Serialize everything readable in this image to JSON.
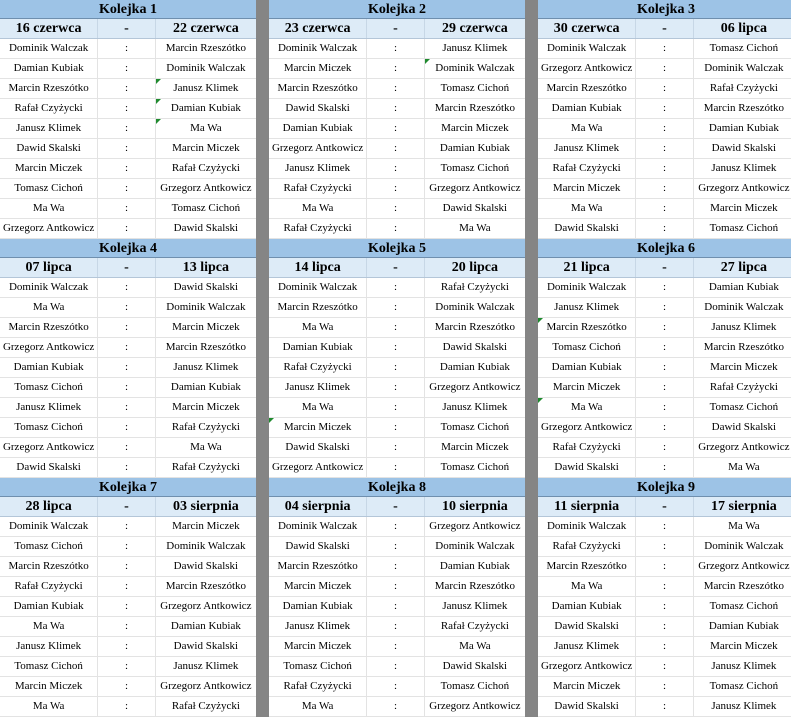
{
  "rounds": [
    {
      "title": "Kolejka 1",
      "date_from": "16 czerwca",
      "date_sep": "-",
      "date_to": "22 czerwca",
      "matches": [
        {
          "home": "Dominik Walczak",
          "sep": ":",
          "away": "Marcin Rzeszótko"
        },
        {
          "home": "Damian Kubiak",
          "sep": ":",
          "away": "Dominik Walczak"
        },
        {
          "home": "Marcin Rzeszótko",
          "sep": ":",
          "away": "Janusz Klimek"
        },
        {
          "home": "Rafał Czyżycki",
          "sep": ":",
          "away": "Damian Kubiak"
        },
        {
          "home": "Janusz Klimek",
          "sep": ":",
          "away": "Ma Wa"
        },
        {
          "home": "Dawid Skalski",
          "sep": ":",
          "away": "Marcin Miczek"
        },
        {
          "home": "Marcin Miczek",
          "sep": ":",
          "away": "Rafał Czyżycki"
        },
        {
          "home": "Tomasz Cichoń",
          "sep": ":",
          "away": "Grzegorz Antkowicz"
        },
        {
          "home": "Ma Wa",
          "sep": ":",
          "away": "Tomasz Cichoń"
        },
        {
          "home": "Grzegorz Antkowicz",
          "sep": ":",
          "away": "Dawid Skalski"
        }
      ]
    },
    {
      "title": "Kolejka 2",
      "date_from": "23 czerwca",
      "date_sep": "-",
      "date_to": "29 czerwca",
      "matches": [
        {
          "home": "Dominik Walczak",
          "sep": ":",
          "away": "Janusz Klimek"
        },
        {
          "home": "Marcin Miczek",
          "sep": ":",
          "away": "Dominik Walczak"
        },
        {
          "home": "Marcin Rzeszótko",
          "sep": ":",
          "away": "Tomasz Cichoń"
        },
        {
          "home": "Dawid Skalski",
          "sep": ":",
          "away": "Marcin Rzeszótko"
        },
        {
          "home": "Damian Kubiak",
          "sep": ":",
          "away": "Marcin Miczek"
        },
        {
          "home": "Grzegorz Antkowicz",
          "sep": ":",
          "away": "Damian Kubiak"
        },
        {
          "home": "Janusz Klimek",
          "sep": ":",
          "away": "Tomasz Cichoń"
        },
        {
          "home": "Rafał Czyżycki",
          "sep": ":",
          "away": "Grzegorz Antkowicz"
        },
        {
          "home": "Ma Wa",
          "sep": ":",
          "away": "Dawid Skalski"
        },
        {
          "home": "Rafał Czyżycki",
          "sep": ":",
          "away": "Ma Wa"
        }
      ]
    },
    {
      "title": "Kolejka 3",
      "date_from": "30 czerwca",
      "date_sep": "-",
      "date_to": "06 lipca",
      "matches": [
        {
          "home": "Dominik Walczak",
          "sep": ":",
          "away": "Tomasz Cichoń"
        },
        {
          "home": "Grzegorz Antkowicz",
          "sep": ":",
          "away": "Dominik Walczak"
        },
        {
          "home": "Marcin Rzeszótko",
          "sep": ":",
          "away": "Rafał Czyżycki"
        },
        {
          "home": "Damian Kubiak",
          "sep": ":",
          "away": "Marcin Rzeszótko"
        },
        {
          "home": "Ma Wa",
          "sep": ":",
          "away": "Damian Kubiak"
        },
        {
          "home": "Janusz Klimek",
          "sep": ":",
          "away": "Dawid Skalski"
        },
        {
          "home": "Rafał Czyżycki",
          "sep": ":",
          "away": "Janusz Klimek"
        },
        {
          "home": "Marcin Miczek",
          "sep": ":",
          "away": "Grzegorz Antkowicz"
        },
        {
          "home": "Ma Wa",
          "sep": ":",
          "away": "Marcin Miczek"
        },
        {
          "home": "Dawid Skalski",
          "sep": ":",
          "away": "Tomasz Cichoń"
        }
      ]
    },
    {
      "title": "Kolejka 4",
      "date_from": "07 lipca",
      "date_sep": "-",
      "date_to": "13 lipca",
      "matches": [
        {
          "home": "Dominik Walczak",
          "sep": ":",
          "away": "Dawid Skalski"
        },
        {
          "home": "Ma Wa",
          "sep": ":",
          "away": "Dominik Walczak"
        },
        {
          "home": "Marcin Rzeszótko",
          "sep": ":",
          "away": "Marcin Miczek"
        },
        {
          "home": "Grzegorz Antkowicz",
          "sep": ":",
          "away": "Marcin Rzeszótko"
        },
        {
          "home": "Damian Kubiak",
          "sep": ":",
          "away": "Janusz Klimek"
        },
        {
          "home": "Tomasz Cichoń",
          "sep": ":",
          "away": "Damian Kubiak"
        },
        {
          "home": "Janusz Klimek",
          "sep": ":",
          "away": "Marcin Miczek"
        },
        {
          "home": "Tomasz Cichoń",
          "sep": ":",
          "away": "Rafał Czyżycki"
        },
        {
          "home": "Grzegorz Antkowicz",
          "sep": ":",
          "away": "Ma Wa"
        },
        {
          "home": "Dawid Skalski",
          "sep": ":",
          "away": "Rafał Czyżycki"
        }
      ]
    },
    {
      "title": "Kolejka 5",
      "date_from": "14 lipca",
      "date_sep": "-",
      "date_to": "20 lipca",
      "matches": [
        {
          "home": "Dominik Walczak",
          "sep": ":",
          "away": "Rafał Czyżycki"
        },
        {
          "home": "Marcin Rzeszótko",
          "sep": ":",
          "away": "Dominik Walczak"
        },
        {
          "home": "Ma Wa",
          "sep": ":",
          "away": "Marcin Rzeszótko"
        },
        {
          "home": "Damian Kubiak",
          "sep": ":",
          "away": "Dawid Skalski"
        },
        {
          "home": "Rafał Czyżycki",
          "sep": ":",
          "away": "Damian Kubiak"
        },
        {
          "home": "Janusz Klimek",
          "sep": ":",
          "away": "Grzegorz Antkowicz"
        },
        {
          "home": "Ma Wa",
          "sep": ":",
          "away": "Janusz Klimek"
        },
        {
          "home": "Marcin Miczek",
          "sep": ":",
          "away": "Tomasz Cichoń"
        },
        {
          "home": "Dawid Skalski",
          "sep": ":",
          "away": "Marcin Miczek"
        },
        {
          "home": "Grzegorz Antkowicz",
          "sep": ":",
          "away": "Tomasz Cichoń"
        }
      ]
    },
    {
      "title": "Kolejka 6",
      "date_from": "21 lipca",
      "date_sep": "-",
      "date_to": "27 lipca",
      "matches": [
        {
          "home": "Dominik Walczak",
          "sep": ":",
          "away": "Damian Kubiak"
        },
        {
          "home": "Janusz Klimek",
          "sep": ":",
          "away": "Dominik Walczak"
        },
        {
          "home": "Marcin Rzeszótko",
          "sep": ":",
          "away": "Janusz Klimek"
        },
        {
          "home": "Tomasz Cichoń",
          "sep": ":",
          "away": "Marcin Rzeszótko"
        },
        {
          "home": "Damian Kubiak",
          "sep": ":",
          "away": "Marcin Miczek"
        },
        {
          "home": "Marcin Miczek",
          "sep": ":",
          "away": "Rafał Czyżycki"
        },
        {
          "home": "Ma Wa",
          "sep": ":",
          "away": "Tomasz Cichoń"
        },
        {
          "home": "Grzegorz Antkowicz",
          "sep": ":",
          "away": "Dawid Skalski"
        },
        {
          "home": "Rafał Czyżycki",
          "sep": ":",
          "away": "Grzegorz Antkowicz"
        },
        {
          "home": "Dawid Skalski",
          "sep": ":",
          "away": "Ma Wa"
        }
      ]
    },
    {
      "title": "Kolejka 7",
      "date_from": "28 lipca",
      "date_sep": "-",
      "date_to": "03 sierpnia",
      "matches": [
        {
          "home": "Dominik Walczak",
          "sep": ":",
          "away": "Marcin Miczek"
        },
        {
          "home": "Tomasz Cichoń",
          "sep": ":",
          "away": "Dominik Walczak"
        },
        {
          "home": "Marcin Rzeszótko",
          "sep": ":",
          "away": "Dawid Skalski"
        },
        {
          "home": "Rafał Czyżycki",
          "sep": ":",
          "away": "Marcin Rzeszótko"
        },
        {
          "home": "Damian Kubiak",
          "sep": ":",
          "away": "Grzegorz Antkowicz"
        },
        {
          "home": "Ma Wa",
          "sep": ":",
          "away": "Damian Kubiak"
        },
        {
          "home": "Janusz Klimek",
          "sep": ":",
          "away": "Dawid Skalski"
        },
        {
          "home": "Tomasz Cichoń",
          "sep": ":",
          "away": "Janusz Klimek"
        },
        {
          "home": "Marcin Miczek",
          "sep": ":",
          "away": "Grzegorz Antkowicz"
        },
        {
          "home": "Ma Wa",
          "sep": ":",
          "away": "Rafał Czyżycki"
        }
      ]
    },
    {
      "title": "Kolejka 8",
      "date_from": "04 sierpnia",
      "date_sep": "-",
      "date_to": "10 sierpnia",
      "matches": [
        {
          "home": "Dominik Walczak",
          "sep": ":",
          "away": "Grzegorz Antkowicz"
        },
        {
          "home": "Dawid Skalski",
          "sep": ":",
          "away": "Dominik Walczak"
        },
        {
          "home": "Marcin Rzeszótko",
          "sep": ":",
          "away": "Damian Kubiak"
        },
        {
          "home": "Marcin Miczek",
          "sep": ":",
          "away": "Marcin Rzeszótko"
        },
        {
          "home": "Damian Kubiak",
          "sep": ":",
          "away": "Janusz Klimek"
        },
        {
          "home": "Janusz Klimek",
          "sep": ":",
          "away": "Rafał Czyżycki"
        },
        {
          "home": "Marcin Miczek",
          "sep": ":",
          "away": "Ma Wa"
        },
        {
          "home": "Tomasz Cichoń",
          "sep": ":",
          "away": "Dawid Skalski"
        },
        {
          "home": "Rafał Czyżycki",
          "sep": ":",
          "away": "Tomasz Cichoń"
        },
        {
          "home": "Ma Wa",
          "sep": ":",
          "away": "Grzegorz Antkowicz"
        }
      ]
    },
    {
      "title": "Kolejka 9",
      "date_from": "11 sierpnia",
      "date_sep": "-",
      "date_to": "17 sierpnia",
      "matches": [
        {
          "home": "Dominik Walczak",
          "sep": ":",
          "away": "Ma Wa"
        },
        {
          "home": "Rafał Czyżycki",
          "sep": ":",
          "away": "Dominik Walczak"
        },
        {
          "home": "Marcin Rzeszótko",
          "sep": ":",
          "away": "Grzegorz Antkowicz"
        },
        {
          "home": "Ma Wa",
          "sep": ":",
          "away": "Marcin Rzeszótko"
        },
        {
          "home": "Damian Kubiak",
          "sep": ":",
          "away": "Tomasz Cichoń"
        },
        {
          "home": "Dawid Skalski",
          "sep": ":",
          "away": "Damian Kubiak"
        },
        {
          "home": "Janusz Klimek",
          "sep": ":",
          "away": "Marcin Miczek"
        },
        {
          "home": "Grzegorz Antkowicz",
          "sep": ":",
          "away": "Janusz Klimek"
        },
        {
          "home": "Marcin Miczek",
          "sep": ":",
          "away": "Tomasz Cichoń"
        },
        {
          "home": "Dawid Skalski",
          "sep": ":",
          "away": "Janusz Klimek"
        }
      ]
    }
  ]
}
